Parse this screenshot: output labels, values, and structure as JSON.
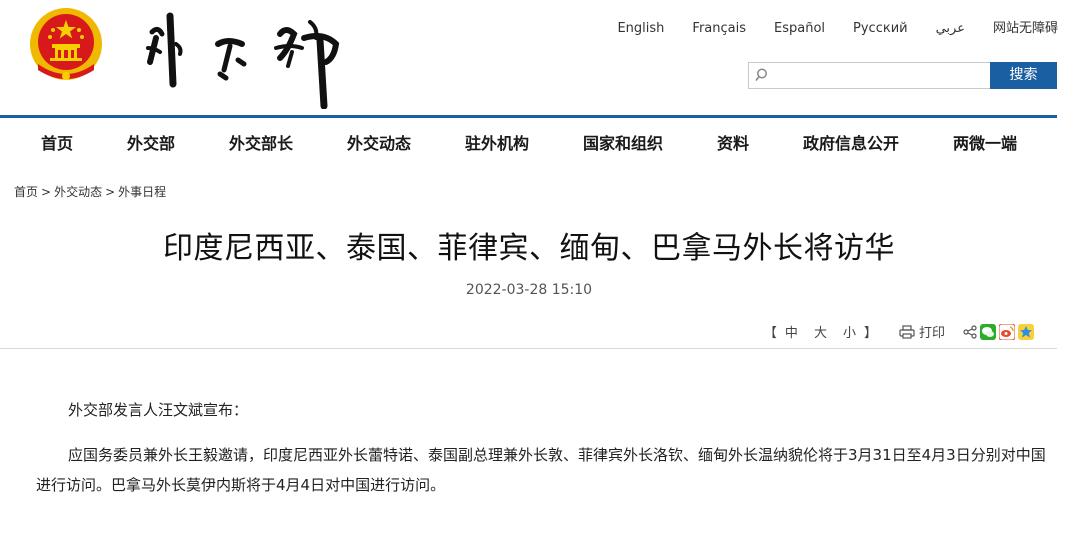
{
  "header": {
    "languages": [
      "English",
      "Français",
      "Español",
      "Русский",
      "عربي",
      "网站无障碍"
    ],
    "search": {
      "placeholder": "",
      "button_label": "搜索"
    }
  },
  "nav": {
    "items": [
      "首页",
      "外交部",
      "外交部长",
      "外交动态",
      "驻外机构",
      "国家和组织",
      "资料",
      "政府信息公开",
      "两微一端"
    ]
  },
  "breadcrumb": [
    "首页",
    "外交动态",
    "外事日程"
  ],
  "article": {
    "title": "印度尼西亚、泰国、菲律宾、缅甸、巴拿马外长将访华",
    "date": "2022-03-28 15:10",
    "paragraphs": [
      "外交部发言人汪文斌宣布：",
      "应国务委员兼外长王毅邀请，印度尼西亚外长蕾特诺、泰国副总理兼外长敦、菲律宾外长洛钦、缅甸外长温纳貌伦将于3月31日至4月3日分别对中国进行访问。巴拿马外长莫伊内斯将于4月4日对中国进行访问。"
    ]
  },
  "tools": {
    "open_bracket": "【",
    "size_large": "中",
    "size_xl": "大",
    "size_small": "小",
    "close_bracket": "】",
    "print_label": "打印"
  },
  "colors": {
    "accent": "#1b5fa3",
    "emblem_red": "#d7191b",
    "emblem_gold": "#f0b800"
  },
  "icons": [
    "national-emblem-icon",
    "search-icon",
    "print-icon",
    "share-icon",
    "wechat-icon",
    "weibo-icon",
    "qzone-icon"
  ]
}
